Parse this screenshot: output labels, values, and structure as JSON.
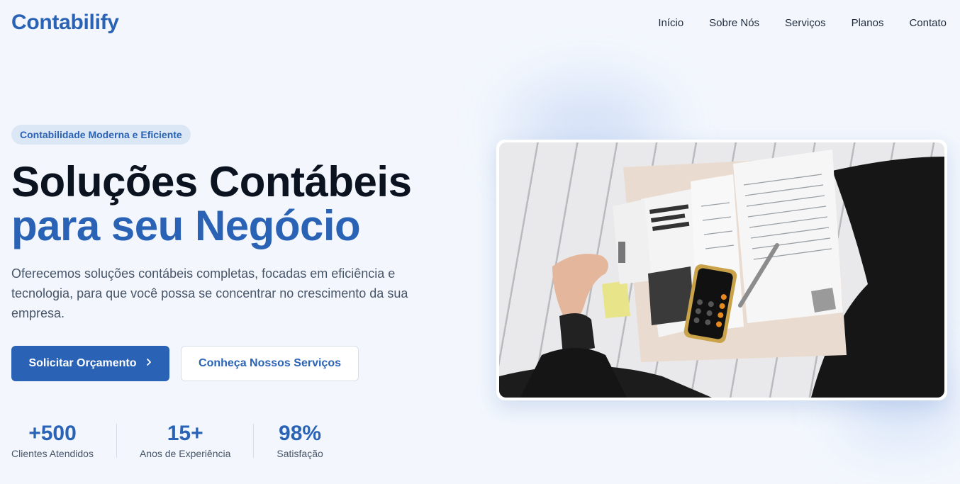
{
  "header": {
    "logo": "Contabilify",
    "nav": [
      "Início",
      "Sobre Nós",
      "Serviços",
      "Planos",
      "Contato"
    ]
  },
  "hero": {
    "badge": "Contabilidade Moderna e Eficiente",
    "title_line1": "Soluções Contábeis",
    "title_line2": "para seu Negócio",
    "description": "Oferecemos soluções contábeis completas, focadas em eficiência e tecnologia, para que você possa se concentrar no crescimento da sua empresa.",
    "primary_button": "Solicitar Orçamento",
    "primary_button_icon": "chevron-right-icon",
    "secondary_button": "Conheça Nossos Serviços"
  },
  "stats": [
    {
      "value": "+500",
      "label": "Clientes Atendidos"
    },
    {
      "value": "15+",
      "label": "Anos de Experiência"
    },
    {
      "value": "98%",
      "label": "Satisfação"
    }
  ],
  "colors": {
    "brand": "#2a63b5",
    "background": "#f3f7fd",
    "text_dark": "#0b1220",
    "text_muted": "#475569"
  }
}
